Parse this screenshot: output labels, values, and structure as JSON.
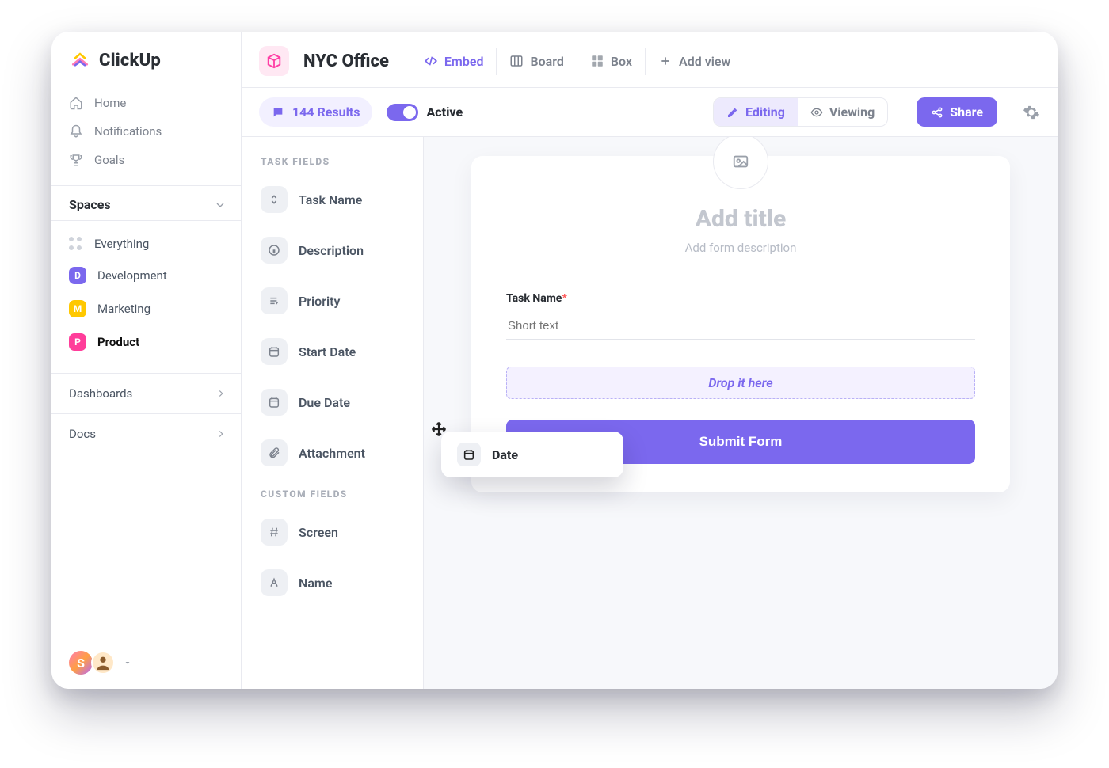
{
  "app": {
    "brand": "ClickUp"
  },
  "sidebar": {
    "nav": [
      {
        "label": "Home",
        "icon": "home"
      },
      {
        "label": "Notifications",
        "icon": "bell"
      },
      {
        "label": "Goals",
        "icon": "trophy"
      }
    ],
    "spaces_header": "Spaces",
    "spaces": [
      {
        "label": "Everything",
        "icon": "everything"
      },
      {
        "label": "Development",
        "badge": "D",
        "color": "#7b68ee"
      },
      {
        "label": "Marketing",
        "badge": "M",
        "color": "#ffc800"
      },
      {
        "label": "Product",
        "badge": "P",
        "color": "#ff3d9a",
        "active": true
      }
    ],
    "dashboards_label": "Dashboards",
    "docs_label": "Docs",
    "footer_initial": "S"
  },
  "header": {
    "space_name": "NYC Office",
    "views": {
      "embed": "Embed",
      "board": "Board",
      "box": "Box",
      "add": "Add view"
    }
  },
  "toolbar": {
    "results_label": "144 Results",
    "active_label": "Active",
    "editing_label": "Editing",
    "viewing_label": "Viewing",
    "share_label": "Share"
  },
  "fields": {
    "task_heading": "TASK FIELDS",
    "task": [
      {
        "label": "Task Name",
        "icon": "updown"
      },
      {
        "label": "Description",
        "icon": "info"
      },
      {
        "label": "Priority",
        "icon": "priority"
      },
      {
        "label": "Start Date",
        "icon": "calendar"
      },
      {
        "label": "Due Date",
        "icon": "calendar"
      },
      {
        "label": "Attachment",
        "icon": "paperclip"
      }
    ],
    "custom_heading": "CUSTOM FIELDS",
    "custom": [
      {
        "label": "Screen",
        "icon": "hash"
      },
      {
        "label": "Name",
        "icon": "letter"
      }
    ]
  },
  "form": {
    "title_placeholder": "Add title",
    "desc_placeholder": "Add form description",
    "field_label": "Task Name",
    "field_required": "*",
    "field_placeholder": "Short text",
    "drop_text": "Drop it here",
    "submit_label": "Submit Form",
    "drag_chip_label": "Date"
  }
}
